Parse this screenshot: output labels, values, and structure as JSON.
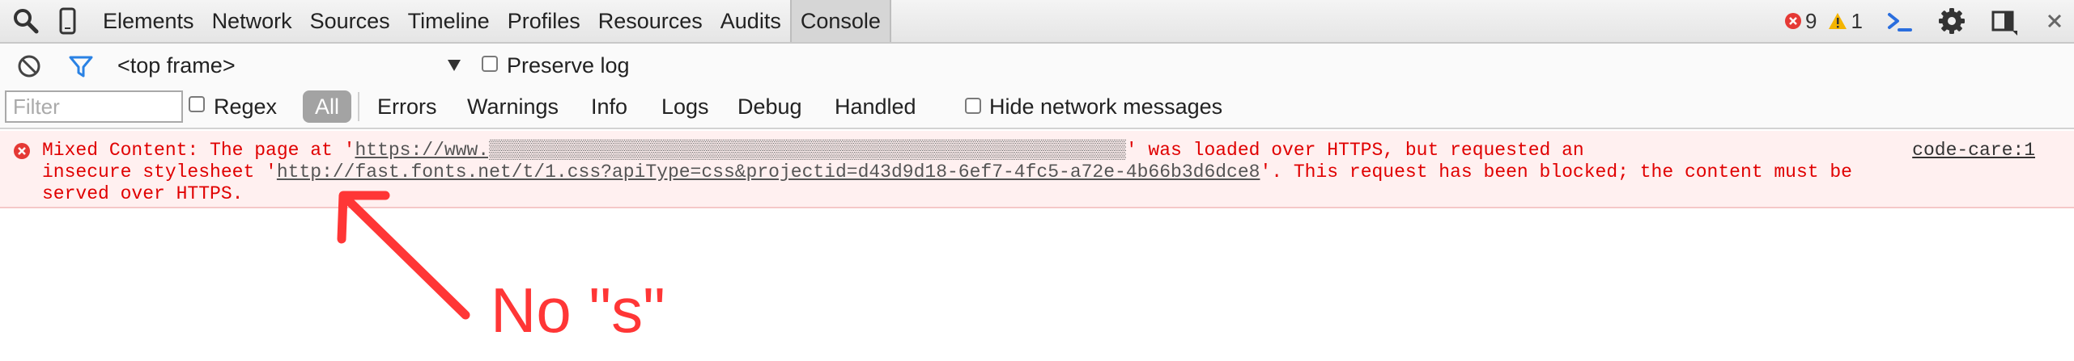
{
  "toolbar": {
    "tabs": [
      {
        "label": "Elements",
        "active": false
      },
      {
        "label": "Network",
        "active": false
      },
      {
        "label": "Sources",
        "active": false
      },
      {
        "label": "Timeline",
        "active": false
      },
      {
        "label": "Profiles",
        "active": false
      },
      {
        "label": "Resources",
        "active": false
      },
      {
        "label": "Audits",
        "active": false
      },
      {
        "label": "Console",
        "active": true
      }
    ],
    "error_count": "9",
    "warning_count": "1",
    "icons": [
      "search-icon",
      "device-icon",
      "error-icon",
      "warning-icon",
      "console-prompt-icon",
      "gear-icon",
      "dock-icon",
      "close-icon"
    ]
  },
  "filterbar": {
    "context_selector": "<top frame>",
    "preserve_log_label": "Preserve log",
    "filter_placeholder": "Filter",
    "regex_label": "Regex",
    "levels": [
      "All",
      "Errors",
      "Warnings",
      "Info",
      "Logs",
      "Debug",
      "Handled"
    ],
    "selected_level": "All",
    "hide_network_label": "Hide network messages"
  },
  "console": {
    "message": {
      "part1": "Mixed Content: The page at '",
      "page_url": "https://www.▒▒▒▒▒▒▒▒▒▒▒▒▒▒▒▒▒▒▒▒▒▒▒▒▒▒▒▒▒▒▒▒▒▒▒▒▒▒▒▒▒▒▒▒▒▒▒▒▒▒▒▒▒▒▒▒▒",
      "part2": "' was loaded over HTTPS, but requested an\ninsecure stylesheet '",
      "stylesheet_url": "http://fast.fonts.net/t/1.css?apiType=css&projectid=d43d9d18-6ef7-4fc5-a72e-4b66b3d6dce8",
      "part3": "'. This request has been blocked; the content must be\nserved over HTTPS.",
      "source": "code-care:1"
    }
  },
  "annotation": {
    "text": "No \"s\"",
    "color": "#ff3636"
  }
}
